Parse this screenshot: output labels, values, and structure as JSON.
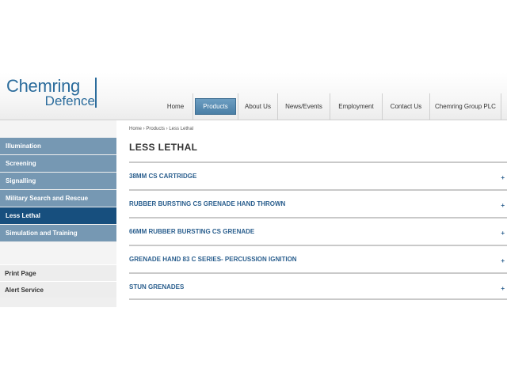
{
  "logo": {
    "line1": "Chemring",
    "line2": "Defence"
  },
  "nav": {
    "items": [
      {
        "label": "Home",
        "width": 44,
        "active": false
      },
      {
        "label": "Products",
        "width": 57,
        "active": true
      },
      {
        "label": "About Us",
        "width": 50,
        "active": false
      },
      {
        "label": "News/Events",
        "width": 66,
        "active": false
      },
      {
        "label": "Employment",
        "width": 66,
        "active": false
      },
      {
        "label": "Contact Us",
        "width": 60,
        "active": false
      },
      {
        "label": "Chemring Group PLC",
        "width": 90,
        "active": false
      }
    ]
  },
  "sidebar": {
    "items": [
      {
        "label": "Illumination",
        "active": false
      },
      {
        "label": "Screening",
        "active": false
      },
      {
        "label": "Signalling",
        "active": false
      },
      {
        "label": "Military Search and Rescue",
        "active": false
      },
      {
        "label": "Less Lethal",
        "active": true
      },
      {
        "label": "Simulation and Training",
        "active": false
      }
    ],
    "utilities": [
      {
        "label": "Print Page"
      },
      {
        "label": "Alert Service"
      }
    ]
  },
  "main": {
    "breadcrumb": "Home › Products › Less Lethal",
    "title": "LESS LETHAL",
    "products": [
      {
        "label": "38MM CS CARTRIDGE",
        "toggle": "+"
      },
      {
        "label": "RUBBER BURSTING CS GRENADE HAND THROWN",
        "toggle": "+"
      },
      {
        "label": "66MM RUBBER BURSTING CS GRENADE",
        "toggle": "+"
      },
      {
        "label": "GRENADE HAND 83 C SERIES- PERCUSSION IGNITION",
        "toggle": "+"
      },
      {
        "label": "STUN GRENADES",
        "toggle": "+"
      }
    ]
  }
}
